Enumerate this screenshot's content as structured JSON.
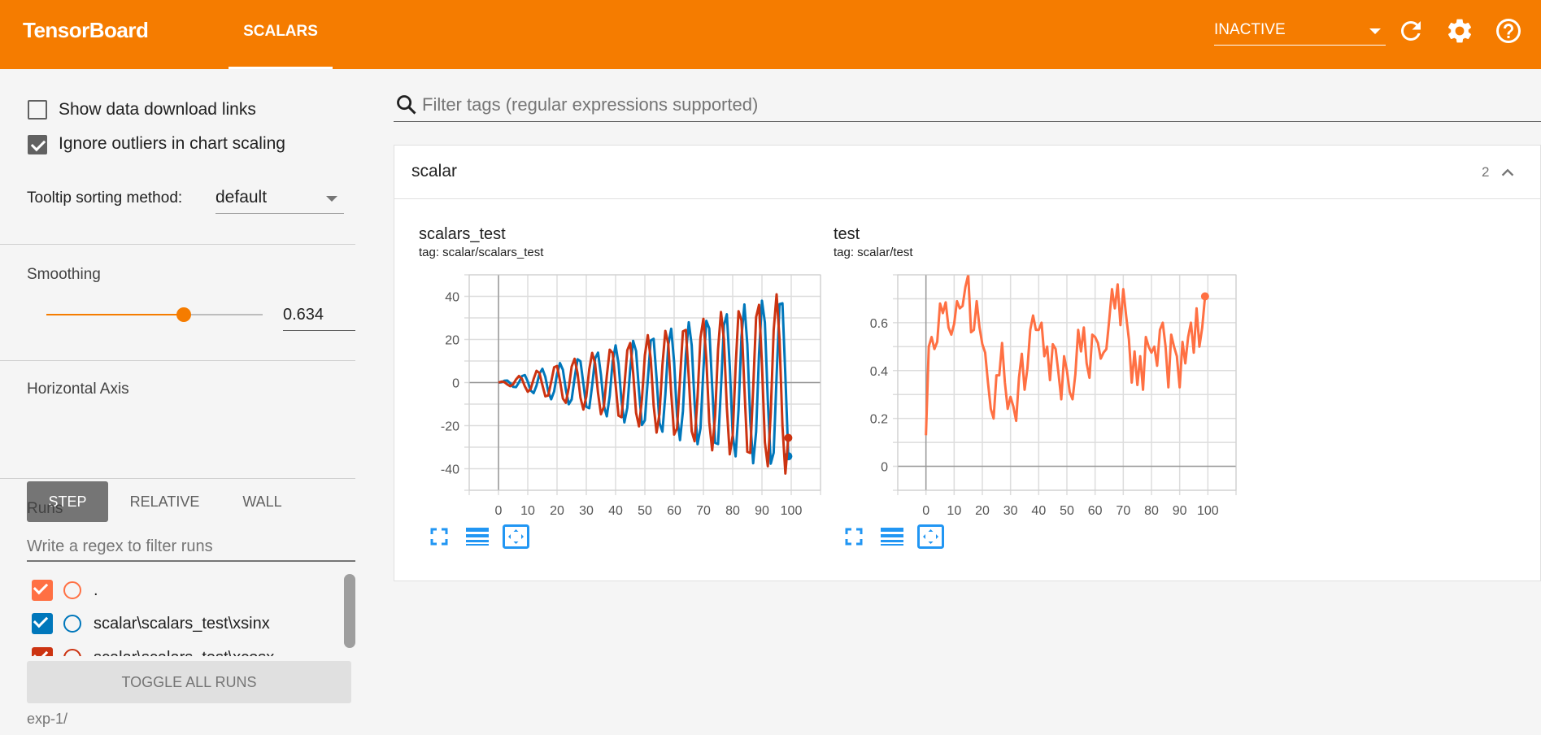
{
  "header": {
    "title": "TensorBoard",
    "tab": "SCALARS",
    "status_select": "INACTIVE",
    "icons": [
      "refresh-icon",
      "settings-icon",
      "help-icon"
    ],
    "color": "#f57c00"
  },
  "sidebar": {
    "show_download_links": {
      "label": "Show data download links",
      "checked": false
    },
    "ignore_outliers": {
      "label": "Ignore outliers in chart scaling",
      "checked": true
    },
    "tooltip_sorting": {
      "label": "Tooltip sorting method:",
      "value": "default"
    },
    "smoothing": {
      "label": "Smoothing",
      "value": "0.634",
      "fraction": 0.634
    },
    "horizontal_axis": {
      "label": "Horizontal Axis",
      "options": [
        "STEP",
        "RELATIVE",
        "WALL"
      ],
      "selected": "STEP"
    },
    "runs": {
      "label": "Runs",
      "filter_placeholder": "Write a regex to filter runs",
      "items": [
        {
          "name": ".",
          "color": "#ff7043",
          "checked": true
        },
        {
          "name": "scalar\\scalars_test\\xsinx",
          "color": "#0077bb",
          "checked": true
        },
        {
          "name": "scalar\\scalars_test\\xcosx",
          "color": "#cc3311",
          "checked": true
        }
      ],
      "toggle_all": "TOGGLE ALL RUNS",
      "footer": "exp-1/"
    }
  },
  "main": {
    "filter_placeholder": "Filter tags (regular expressions supported)",
    "group": {
      "name": "scalar",
      "count": "2"
    }
  },
  "chart_data": [
    {
      "type": "line",
      "title": "scalars_test",
      "subtitle": "tag: scalar/scalars_test",
      "xlim": [
        -10,
        110
      ],
      "ylim": [
        -50,
        50
      ],
      "xticks": [
        0,
        10,
        20,
        30,
        40,
        50,
        60,
        70,
        80,
        90,
        100
      ],
      "yticks": [
        -40,
        -20,
        0,
        20,
        40
      ],
      "grid": true,
      "x_start": 0,
      "series": [
        {
          "run": "scalar\\scalars_test\\xsinx",
          "color": "#0077bb",
          "values": [
            0,
            0.14,
            0.84,
            0.95,
            -0.3,
            -2.0,
            -2.13,
            0.11,
            2.97,
            3.48,
            0.46,
            -3.7,
            -4.91,
            -1.38,
            4.13,
            6.38,
            2.63,
            -4.21,
            -7.77,
            -4.15,
            3.91,
            9.03,
            5.93,
            -3.18,
            -10.07,
            -7.85,
            2.08,
            10.81,
            9.88,
            -0.55,
            -11.22,
            -11.92,
            -1.34,
            11.19,
            13.88,
            3.57,
            -10.75,
            -15.7,
            -6.09,
            9.79,
            17.26,
            8.84,
            -8.36,
            -18.5,
            -11.71,
            6.43,
            19.34,
            14.62,
            -4.02,
            -19.71,
            -17.52,
            1.19,
            19.52,
            20.29,
            2.03,
            -18.79,
            -22.81,
            -5.61,
            17.46,
            24.98,
            9.38,
            -15.52,
            -26.73,
            -13.34,
            12.97,
            27.99,
            17.34,
            -9.81,
            -28.64,
            -21.25,
            6.17,
            28.65,
            25.07,
            -1.99,
            -27.97,
            -28.54,
            -2.63,
            26.48,
            31.67,
            7.51,
            -24.3,
            -34.26,
            -12.58,
            21.33,
            36.22,
            17.77,
            -17.68,
            -37.47,
            -22.89,
            13.3,
            37.95,
            27.87,
            -8.35,
            -37.64,
            -32.57,
            2.87,
            36.37,
            36.79,
            3.01,
            -34.21
          ]
        },
        {
          "run": "scalar\\scalars_test\\xcosx",
          "color": "#cc3311",
          "values": [
            0,
            0.41,
            0.22,
            -0.88,
            -1.7,
            -0.83,
            1.47,
            3.02,
            1.76,
            -1.74,
            -4.29,
            -2.98,
            1.64,
            5.45,
            4.42,
            -1.17,
            -6.39,
            -6.02,
            0.3,
            7.08,
            7.71,
            0.92,
            -7.43,
            -9.41,
            -2.5,
            7.42,
            11.04,
            4.36,
            -6.98,
            -12.52,
            -6.48,
            6.11,
            13.76,
            8.82,
            -4.79,
            -14.7,
            -11.24,
            3.02,
            15.25,
            13.71,
            -0.85,
            -15.36,
            -16.09,
            -1.69,
            14.98,
            18.35,
            4.59,
            -14.09,
            -20.34,
            -7.73,
            12.64,
            22.01,
            11.1,
            -10.65,
            -23.23,
            -14.54,
            8.1,
            23.98,
            17.97,
            -5.07,
            -24.16,
            -21.29,
            1.55,
            23.73,
            24.41,
            2.33,
            -22.64,
            -27.24,
            -6.55,
            20.9,
            29.6,
            10.95,
            -18.44,
            -31.47,
            -15.47,
            15.33,
            32.73,
            20.12,
            -11.52,
            -33.31,
            -24.57,
            7.21,
            33.12,
            28.83,
            -2.4,
            -32.13,
            -32.66,
            -2.82,
            30.37,
            36.06,
            8.4,
            -27.71,
            -38.87,
            -14.06,
            24.28,
            40.96,
            19.91,
            -20.07,
            -42.21,
            -25.66
          ]
        }
      ]
    },
    {
      "type": "line",
      "title": "test",
      "subtitle": "tag: scalar/test",
      "xlim": [
        -10,
        110
      ],
      "ylim": [
        -0.1,
        0.8
      ],
      "xticks": [
        0,
        10,
        20,
        30,
        40,
        50,
        60,
        70,
        80,
        90,
        100
      ],
      "yticks": [
        0,
        0.2,
        0.4,
        0.6
      ],
      "grid": true,
      "x_start": 0,
      "series": [
        {
          "run": ".",
          "color": "#ff7043",
          "values": [
            0.13,
            0.5,
            0.54,
            0.49,
            0.52,
            0.68,
            0.64,
            0.685,
            0.58,
            0.55,
            0.595,
            0.69,
            0.66,
            0.67,
            0.75,
            0.8,
            0.56,
            0.57,
            0.69,
            0.58,
            0.51,
            0.475,
            0.35,
            0.24,
            0.2,
            0.38,
            0.38,
            0.515,
            0.35,
            0.24,
            0.29,
            0.25,
            0.19,
            0.37,
            0.47,
            0.32,
            0.41,
            0.57,
            0.63,
            0.57,
            0.57,
            0.6,
            0.46,
            0.5,
            0.36,
            0.51,
            0.49,
            0.39,
            0.28,
            0.46,
            0.4,
            0.31,
            0.28,
            0.385,
            0.57,
            0.48,
            0.58,
            0.43,
            0.37,
            0.55,
            0.54,
            0.515,
            0.45,
            0.475,
            0.49,
            0.61,
            0.74,
            0.66,
            0.76,
            0.59,
            0.74,
            0.63,
            0.53,
            0.35,
            0.48,
            0.34,
            0.46,
            0.32,
            0.54,
            0.5,
            0.475,
            0.5,
            0.42,
            0.57,
            0.6,
            0.5,
            0.33,
            0.55,
            0.5,
            0.46,
            0.33,
            0.52,
            0.43,
            0.54,
            0.6,
            0.475,
            0.66,
            0.5,
            0.58,
            0.71
          ]
        }
      ]
    }
  ]
}
